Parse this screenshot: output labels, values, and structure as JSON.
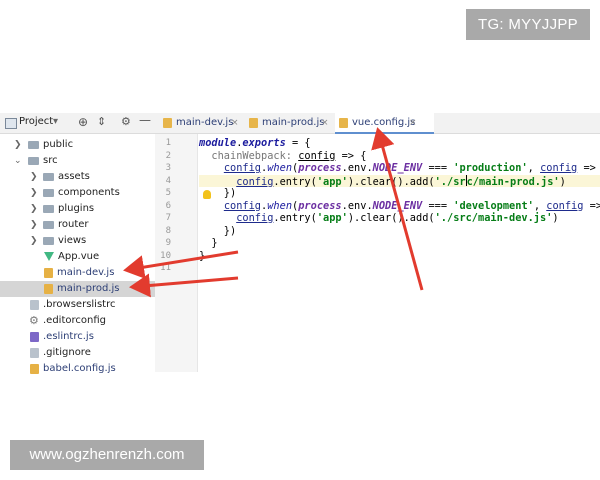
{
  "watermarks": {
    "tg": "TG: MYYJJPP",
    "site": "www.ogzhenrenzh.com"
  },
  "project_panel": {
    "title": "Project",
    "dropdown": "▾"
  },
  "tabs": [
    {
      "label": "main-dev.js",
      "close": "×"
    },
    {
      "label": "main-prod.js",
      "close": "×"
    },
    {
      "label": "vue.config.js",
      "close": "×",
      "active": true
    }
  ],
  "tree": [
    {
      "label": "public",
      "type": "folder",
      "depth": 1,
      "expanded": false
    },
    {
      "label": "src",
      "type": "folder",
      "depth": 1,
      "expanded": true
    },
    {
      "label": "assets",
      "type": "folder",
      "depth": 2,
      "expanded": false
    },
    {
      "label": "components",
      "type": "folder",
      "depth": 2,
      "expanded": false
    },
    {
      "label": "plugins",
      "type": "folder",
      "depth": 2,
      "expanded": false
    },
    {
      "label": "router",
      "type": "folder",
      "depth": 2,
      "expanded": false
    },
    {
      "label": "views",
      "type": "folder",
      "depth": 2,
      "expanded": false
    },
    {
      "label": "App.vue",
      "type": "vue",
      "depth": 2
    },
    {
      "label": "main-dev.js",
      "type": "js",
      "depth": 2
    },
    {
      "label": "main-prod.js",
      "type": "js",
      "depth": 2,
      "selected": true
    },
    {
      "label": ".browserslistrc",
      "type": "file",
      "depth": 1
    },
    {
      "label": ".editorconfig",
      "type": "file",
      "depth": 1
    },
    {
      "label": ".eslintrc.js",
      "type": "file",
      "depth": 1
    },
    {
      "label": ".gitignore",
      "type": "file",
      "depth": 1
    },
    {
      "label": "babel.config.js",
      "type": "js",
      "depth": 1
    }
  ],
  "editor": {
    "line_numbers": [
      "1",
      "2",
      "3",
      "4",
      "5",
      "6",
      "7",
      "8",
      "9",
      "10",
      "11"
    ],
    "cursor_line": 4,
    "code": {
      "l1_kw": "module",
      "l1_a": ".",
      "l1_prop": "exports",
      "l1_b": " = {",
      "l2_a": "  chainWebpack: ",
      "l2_param": "config",
      "l2_b": " => {",
      "l3_a": "    ",
      "l3_obj": "config",
      "l3_dot": ".",
      "l3_fn": "when",
      "l3_p": "(",
      "l3_pr": "process",
      "l3_env": ".env.",
      "l3_const": "NODE_ENV",
      "l3_eq": " === ",
      "l3_str": "'production'",
      "l3_c": ", ",
      "l3_param": "config",
      "l3_arrow": " =>",
      "l4_a": "      ",
      "l4_obj": "config",
      "l4_b": ".entry(",
      "l4_s1": "'app'",
      "l4_c": ").clear().add(",
      "l4_s2a": "'./sr",
      "l4_s2b": "c/main-prod.js'",
      "l4_d": ")",
      "l5": "    })",
      "l6_a": "    ",
      "l6_obj": "config",
      "l6_dot": ".",
      "l6_fn": "when",
      "l6_p": "(",
      "l6_pr": "process",
      "l6_env": ".env.",
      "l6_const": "NODE_ENV",
      "l6_eq": " === ",
      "l6_str": "'development'",
      "l6_c": ", ",
      "l6_param": "config",
      "l6_arrow": " =>",
      "l7_a": "      ",
      "l7_obj": "config",
      "l7_b": ".entry(",
      "l7_s1": "'app'",
      "l7_c": ").clear().add(",
      "l7_s2": "'./src/main-dev.js'",
      "l7_d": ")",
      "l8": "    })",
      "l9": "  }",
      "l10": "}"
    }
  },
  "colors": {
    "arrow": "#e23b2e",
    "keyword": "#1b1b9e",
    "string": "#067d17",
    "selection": "#d5d5d5"
  }
}
